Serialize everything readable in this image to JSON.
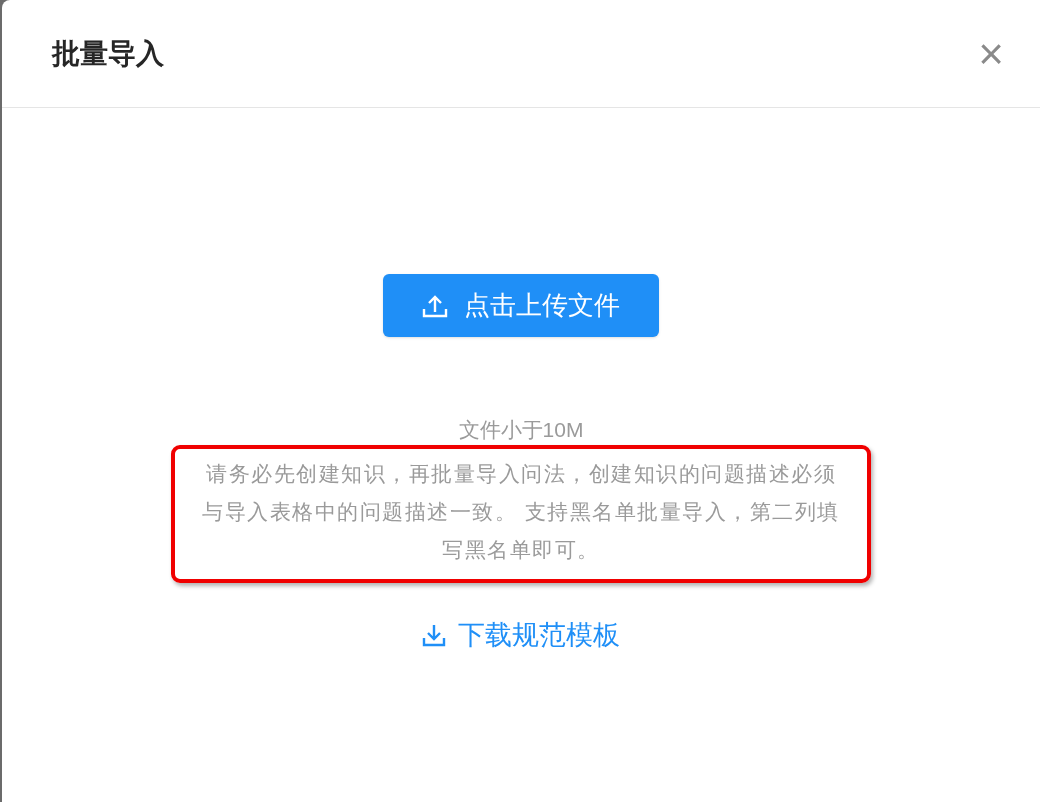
{
  "dialog": {
    "title": "批量导入",
    "close": "×"
  },
  "upload_button": {
    "label": "点击上传文件"
  },
  "size_hint": "文件小于10M",
  "notice": "请务必先创建知识，再批量导入问法，创建知识的问题描述必须与导入表格中的问题描述一致。 支持黑名单批量导入，第二列填写黑名单即可。",
  "template_link": {
    "label": "下载规范模板"
  }
}
